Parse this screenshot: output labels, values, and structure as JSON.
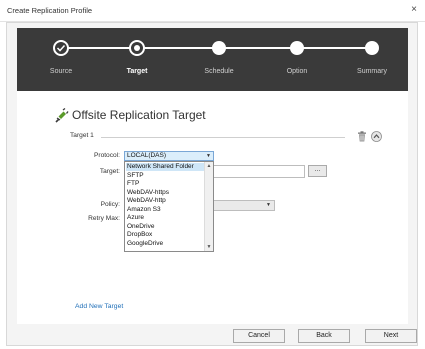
{
  "window": {
    "title": "Create Replication Profile",
    "close_glyph": "×"
  },
  "wizard": {
    "steps": [
      {
        "label": "Source",
        "state": "done"
      },
      {
        "label": "Target",
        "state": "current"
      },
      {
        "label": "Schedule",
        "state": "pending"
      },
      {
        "label": "Option",
        "state": "pending"
      },
      {
        "label": "Summary",
        "state": "pending"
      }
    ]
  },
  "section": {
    "title": "Offsite Replication Target",
    "icon": "plug-icon"
  },
  "target": {
    "label": "Target 1"
  },
  "form": {
    "protocol_label": "Protocol:",
    "protocol_value": "LOCAL(DAS)",
    "target_label": "Target:",
    "browse_label": "...",
    "policy_label": "Policy:",
    "retry_label": "Retry Max:"
  },
  "protocol_options": [
    "Network Shared Folder",
    "SFTP",
    "FTP",
    "WebDAV-https",
    "WebDAV-http",
    "Amazon S3",
    "Azure",
    "OneDrive",
    "DropBox",
    "GoogleDrive"
  ],
  "add_target_label": "Add New Target",
  "buttons": {
    "cancel": "Cancel",
    "back": "Back",
    "next": "Next"
  },
  "colors": {
    "accent": "#3a3a3a",
    "highlight": "#cfe6f7",
    "link": "#1f6fb8"
  }
}
